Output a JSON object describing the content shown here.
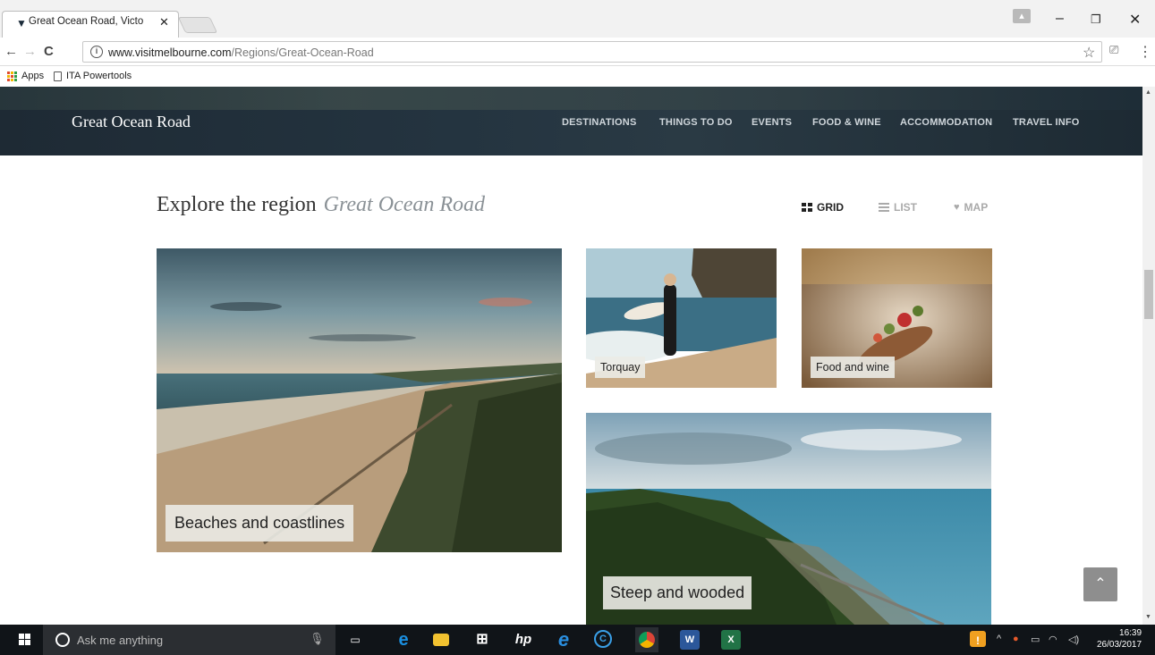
{
  "browser": {
    "tab_title": "Great Ocean Road, Victo",
    "tab_close": "✕",
    "url_host": "www.visitmelbourne.com",
    "url_path": "/Regions/Great-Ocean-Road",
    "bookmarks": [
      {
        "label": "Apps"
      },
      {
        "label": "ITA Powertools"
      }
    ],
    "window_controls": {
      "minimize": "–",
      "restore": "❐",
      "close": "✕"
    }
  },
  "site": {
    "logo": "Great Ocean Road",
    "nav": [
      "DESTINATIONS",
      "THINGS TO DO",
      "EVENTS",
      "FOOD & WINE",
      "ACCOMMODATION",
      "TRAVEL INFO"
    ],
    "heading": "Explore the region",
    "heading_region": "Great Ocean Road",
    "view_options": {
      "grid": "GRID",
      "list": "LIST",
      "map": "MAP",
      "active": "grid"
    },
    "tiles": [
      {
        "label": "Beaches and coastlines"
      },
      {
        "label": "Torquay"
      },
      {
        "label": "Food and wine"
      },
      {
        "label": "Steep and wooded"
      }
    ],
    "scroll_top_icon": "chevron-up-icon"
  },
  "taskbar": {
    "search_placeholder": "Ask me anything",
    "time": "16:39",
    "date": "26/03/2017"
  },
  "colors": {
    "site_header": "#1e2a34",
    "taskbar": "#101418",
    "scroll_top": "#8e8e8e"
  }
}
